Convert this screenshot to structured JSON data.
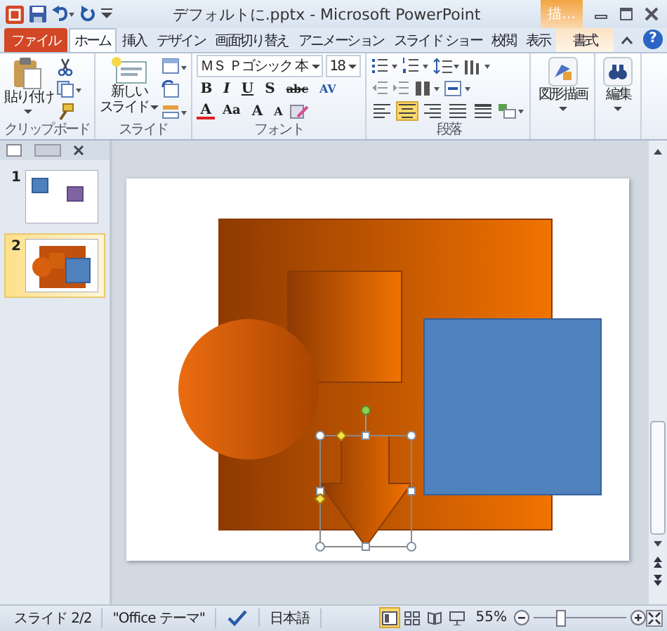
{
  "window": {
    "title": "デフォルトに.pptx - Microsoft PowerPoint",
    "contextual_group": "描…",
    "help_button": "?"
  },
  "tabs": [
    {
      "label": "ファイル",
      "kind": "file",
      "selected": false
    },
    {
      "label": "ホーム",
      "kind": "tab",
      "selected": true
    },
    {
      "label": "挿入",
      "kind": "tab",
      "selected": false
    },
    {
      "label": "デザイン",
      "kind": "tab",
      "selected": false
    },
    {
      "label": "画面切り替え",
      "kind": "tab",
      "selected": false
    },
    {
      "label": "アニメーション",
      "kind": "tab",
      "selected": false
    },
    {
      "label": "スライド ショー",
      "kind": "tab",
      "selected": false
    },
    {
      "label": "校閲",
      "kind": "tab",
      "selected": false
    },
    {
      "label": "表示",
      "kind": "tab",
      "selected": false
    },
    {
      "label": "書式",
      "kind": "contextual",
      "selected": false
    }
  ],
  "ribbon": {
    "clipboard": {
      "paste": "貼り付け",
      "group_label": "クリップボード"
    },
    "slides": {
      "new_slide": [
        "新しい",
        "スライド"
      ],
      "group_label": "スライド"
    },
    "font": {
      "font_name": "ＭＳ Ｐゴシック 本",
      "font_size": "18",
      "format_buttons": [
        "B",
        "I",
        "U",
        "S",
        "abc",
        "AV"
      ],
      "size_buttons": [
        "A",
        "Aa",
        "A",
        "A"
      ],
      "group_label": "フォント"
    },
    "paragraph": {
      "alignment_buttons": [
        {
          "selected": false
        },
        {
          "selected": true
        },
        {
          "selected": false
        },
        {
          "selected": false
        },
        {
          "selected": false
        }
      ],
      "group_label": "段落"
    },
    "drawing": {
      "label": "図形描画"
    },
    "editing": {
      "label": "編集"
    }
  },
  "slides_panel": [
    {
      "number": "1",
      "selected": false
    },
    {
      "number": "2",
      "selected": true
    }
  ],
  "slide": {
    "shapes": [
      {
        "kind": "gradient-rectangle",
        "selected": false
      },
      {
        "kind": "gradient-rectangle",
        "selected": false
      },
      {
        "kind": "gradient-circle",
        "selected": false
      },
      {
        "kind": "rectangle",
        "selected": false
      },
      {
        "kind": "down-arrow",
        "selected": true
      }
    ]
  },
  "status_bar": {
    "slide_info": "スライド 2/2",
    "theme": "\"Office テーマ\"",
    "language": "日本語",
    "view_buttons": [
      {
        "selected": true
      },
      {
        "selected": false
      },
      {
        "selected": false
      },
      {
        "selected": false
      }
    ],
    "zoom": "55%",
    "zoom_slider": {
      "level": 0.27
    }
  }
}
